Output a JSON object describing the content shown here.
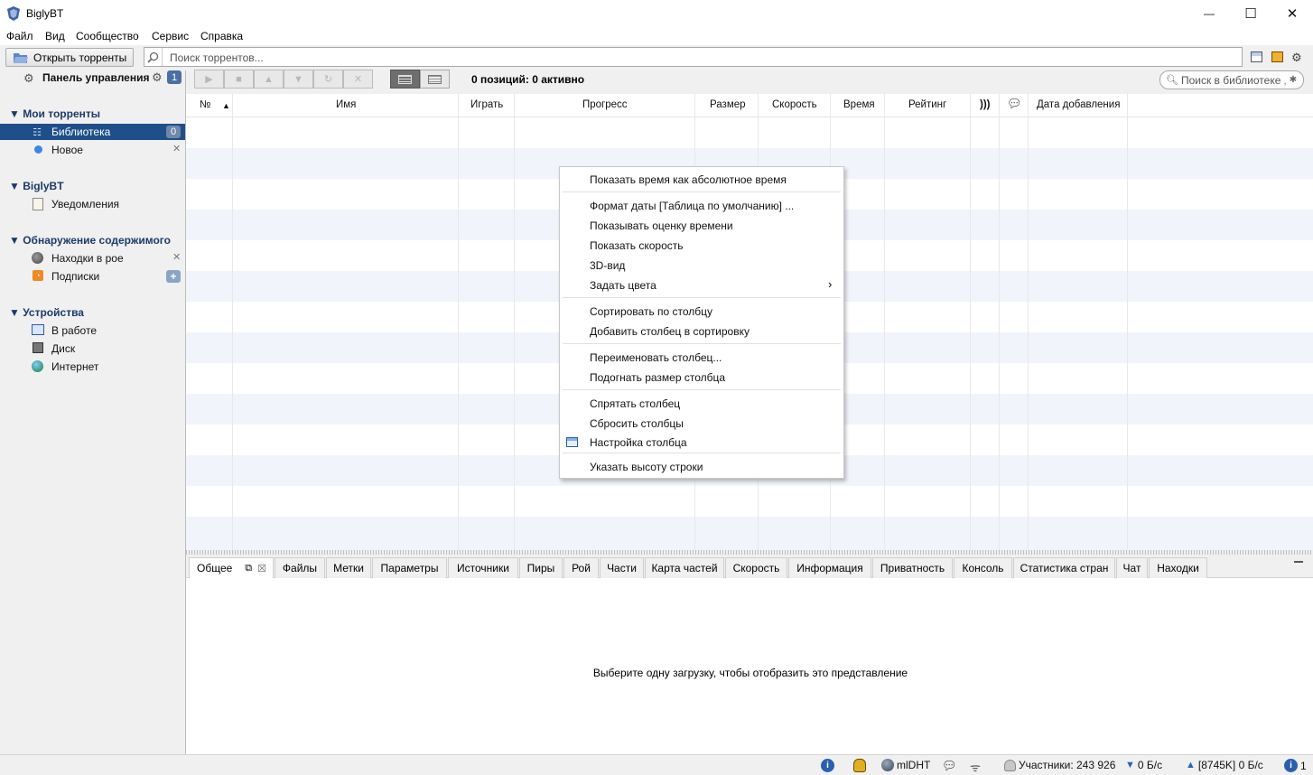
{
  "app": {
    "title": "BiglyBT",
    "window_controls": {
      "minimize": "—",
      "maximize": "☐",
      "close": "✕"
    }
  },
  "menubar": [
    "Файл",
    "Вид",
    "Сообщество",
    "Сервис",
    "Справка"
  ],
  "toolbar": {
    "open_torrents": "Открыть торренты",
    "search_placeholder": "Поиск торрентов...",
    "dashboard_label": "Панель управления",
    "dashboard_badge": "1"
  },
  "sidebar": {
    "my_torrents": {
      "header": "Мои торренты",
      "library": "Библиотека",
      "library_count": "0",
      "new": "Новое"
    },
    "biglybt": {
      "header": "BiglyBT",
      "notifications": "Уведомления"
    },
    "discovery": {
      "header": "Обнаружение содержимого",
      "swarm_finds": "Находки в рое",
      "subscriptions": "Подписки"
    },
    "devices": {
      "header": "Устройства",
      "in_progress": "В работе",
      "disk": "Диск",
      "internet": "Интернет"
    }
  },
  "main": {
    "status": "0 позиций: 0 активно",
    "library_search": "Поиск в библиотеке"
  },
  "table": {
    "columns": [
      "№",
      "Имя",
      "Играть",
      "Прогресс",
      "Размер",
      "Скорость",
      "Время",
      "Рейтинг",
      "",
      "",
      "Дата добавления"
    ]
  },
  "context_menu": {
    "items": [
      "Показать время как абсолютное время",
      "Формат даты [Таблица по умолчанию] ...",
      "Показывать оценку времени",
      "Показать скорость",
      "3D-вид",
      "Задать цвета",
      "Сортировать по столбцу",
      "Добавить столбец в сортировку",
      "Переименовать столбец...",
      "Подогнать размер столбца",
      "Спрятать столбец",
      "Сбросить столбцы",
      "Настройка столбца",
      "Указать высоту строки"
    ],
    "submenu_arrow": "›"
  },
  "tabs": [
    "Общее",
    "Файлы",
    "Метки",
    "Параметры",
    "Источники",
    "Пиры",
    "Рой",
    "Части",
    "Карта частей",
    "Скорость",
    "Информация",
    "Приватность",
    "Консоль",
    "Статистика стран",
    "Чат",
    "Находки"
  ],
  "bottom": {
    "message": "Выберите одну загрузку, чтобы отобразить это представление"
  },
  "statusbar": {
    "dht": "mlDHT",
    "peers": "Участники: 243 926",
    "down": "0 Б/с",
    "up": "[8745K] 0 Б/с",
    "info_count": "1"
  },
  "colors": {
    "selection": "#1e4f8a",
    "stripe": "#f2f4fb",
    "accent": "#4a6fa5"
  }
}
